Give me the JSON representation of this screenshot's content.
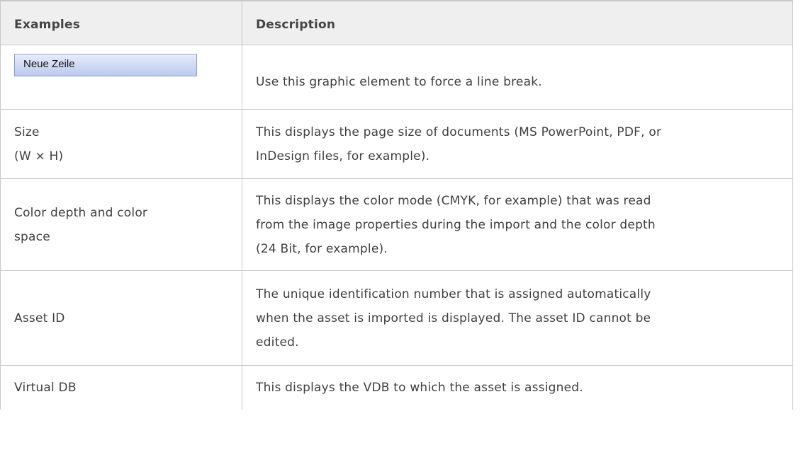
{
  "table": {
    "headers": {
      "examples": "Examples",
      "description": "Description"
    },
    "rows": [
      {
        "example_button_label": "Neue Zeile",
        "description": "Use this graphic element to force a line break."
      },
      {
        "example_line1": "Size",
        "example_line2": "(W × H)",
        "description_line1": "This displays the page size of documents (MS PowerPoint, PDF, or",
        "description_line2": "InDesign files, for example)."
      },
      {
        "example_line1": "Color depth and color",
        "example_line2": "space",
        "description_line1": "This displays the color mode (CMYK, for example) that was read",
        "description_line2": "from the image properties during the import and the color depth",
        "description_line3": "(24 Bit, for example)."
      },
      {
        "example": "Asset ID",
        "description_line1": "The unique identification number that is assigned automatically",
        "description_line2": "when the asset is imported is displayed. The asset ID cannot be",
        "description_line3": "edited."
      },
      {
        "example": "Virtual DB",
        "description": "This displays the VDB to which the asset is assigned."
      }
    ]
  }
}
